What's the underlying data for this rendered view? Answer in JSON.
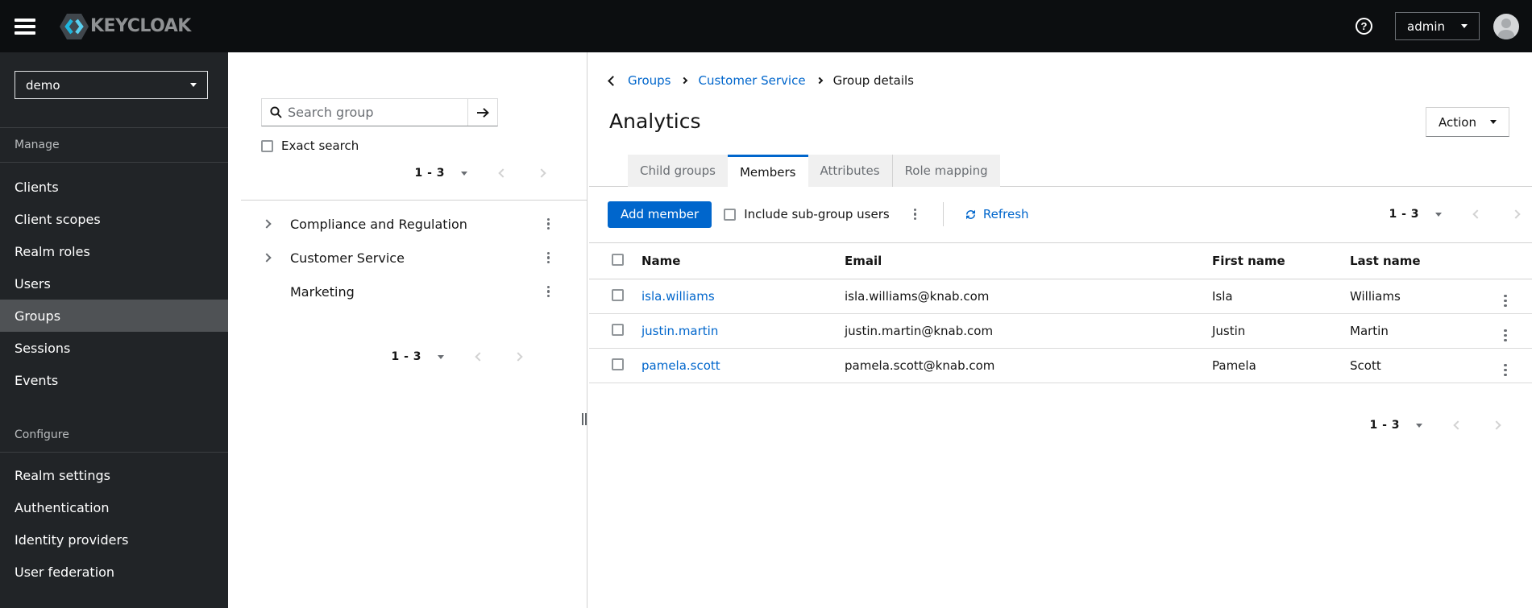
{
  "header": {
    "logo_text": "KEYCLOAK",
    "user_menu": "admin"
  },
  "icons": {
    "help_glyph": "?"
  },
  "sidebar": {
    "realm_selector": "demo",
    "sections": [
      {
        "label": "Manage",
        "items": [
          "Clients",
          "Client scopes",
          "Realm roles",
          "Users",
          "Groups",
          "Sessions",
          "Events"
        ],
        "selected_item": "Groups"
      },
      {
        "label": "Configure",
        "items": [
          "Realm settings",
          "Authentication",
          "Identity providers",
          "User federation"
        ]
      }
    ]
  },
  "group_tree_panel": {
    "search_placeholder": "Search group",
    "exact_search_label": "Exact search",
    "pagination": {
      "range": "1 - 3"
    },
    "groups": [
      {
        "name": "Compliance and Regulation",
        "expandable": true
      },
      {
        "name": "Customer Service",
        "expandable": true
      },
      {
        "name": "Marketing",
        "expandable": false
      }
    ]
  },
  "main": {
    "breadcrumb": {
      "items": [
        "Groups",
        "Customer Service",
        "Group details"
      ]
    },
    "title": "Analytics",
    "action_button": "Action",
    "tabs": [
      {
        "label": "Child groups",
        "active": false
      },
      {
        "label": "Members",
        "active": true
      },
      {
        "label": "Attributes",
        "active": false
      },
      {
        "label": "Role mapping",
        "active": false
      }
    ],
    "toolbar": {
      "add_member_button": "Add member",
      "include_subgroups_label": "Include sub-group users",
      "refresh_label": "Refresh",
      "pagination_range": "1 - 3"
    },
    "members_table": {
      "columns": [
        "Name",
        "Email",
        "First name",
        "Last name"
      ],
      "rows": [
        {
          "name": "isla.williams",
          "email": "isla.williams@knab.com",
          "first_name": "Isla",
          "last_name": "Williams"
        },
        {
          "name": "justin.martin",
          "email": "justin.martin@knab.com",
          "first_name": "Justin",
          "last_name": "Martin"
        },
        {
          "name": "pamela.scott",
          "email": "pamela.scott@knab.com",
          "first_name": "Pamela",
          "last_name": "Scott"
        }
      ],
      "pagination_range": "1 - 3"
    }
  },
  "colors": {
    "accent": "#0066cc",
    "link": "#0066cc",
    "masthead_bg": "#0c0e10",
    "sidebar_bg": "#212427",
    "selected_nav_bg": "#4f5255"
  }
}
